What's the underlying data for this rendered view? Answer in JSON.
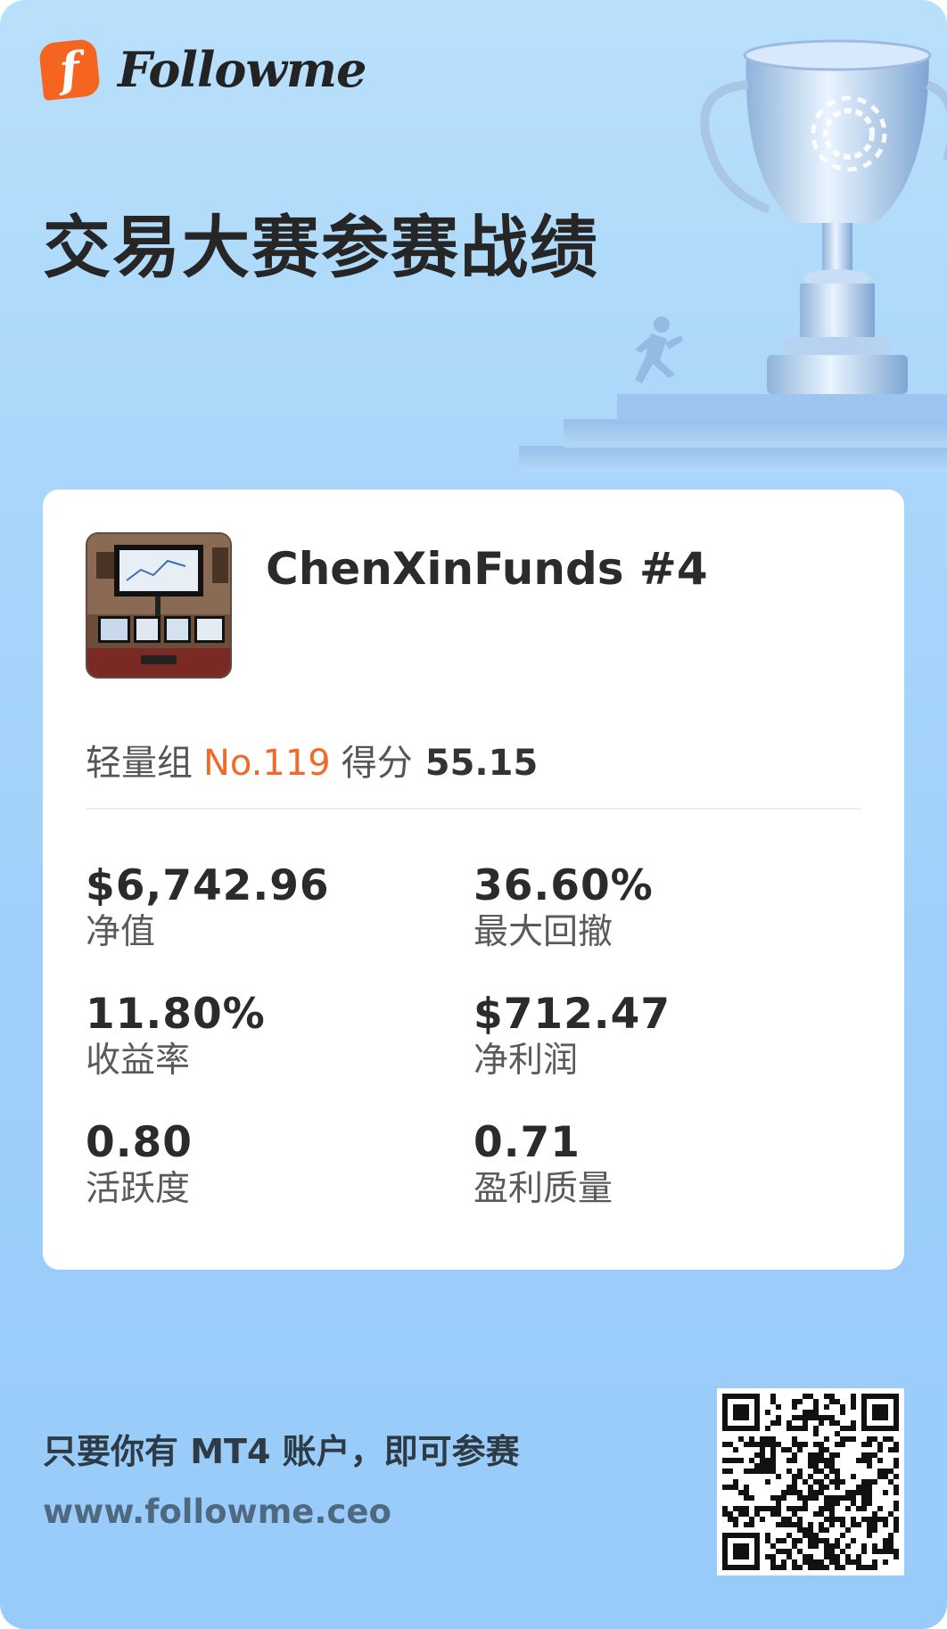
{
  "brand": {
    "logo_letter": "f",
    "name": "Followme"
  },
  "header": {
    "title": "交易大赛参赛战绩"
  },
  "trader": {
    "name": "ChenXinFunds",
    "account_tag": "#4",
    "group": "轻量组",
    "rank": "No.119",
    "score_label": "得分",
    "score": "55.15"
  },
  "stats": [
    {
      "value": "$6,742.96",
      "label": "净值"
    },
    {
      "value": "36.60%",
      "label": "最大回撤"
    },
    {
      "value": "11.80%",
      "label": "收益率"
    },
    {
      "value": "$712.47",
      "label": "净利润"
    },
    {
      "value": "0.80",
      "label": "活跃度"
    },
    {
      "value": "0.71",
      "label": "盈利质量"
    }
  ],
  "footer": {
    "cta": "只要你有 MT4 账户，即可参赛",
    "url": "www.followme.ceo"
  },
  "colors": {
    "accent": "#f26a2a",
    "background": "#a9d6fa",
    "card": "#ffffff"
  },
  "icons": {
    "logo": "followme-logo-icon",
    "trophy": "trophy-icon",
    "runner": "runner-icon",
    "qr": "qr-code"
  }
}
